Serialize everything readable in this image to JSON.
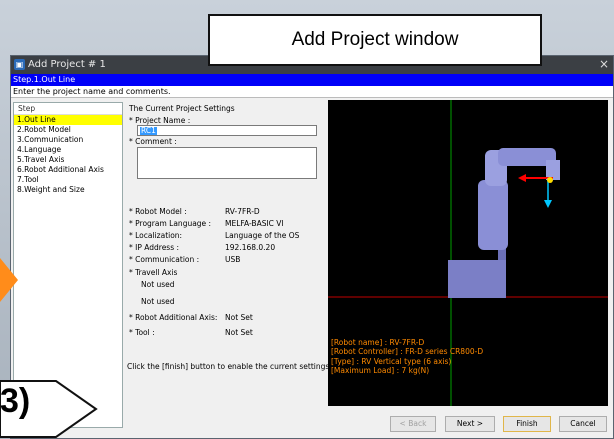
{
  "annotation": {
    "title": "Add Project window",
    "callout": "3)"
  },
  "window": {
    "title": "Add Project # 1",
    "step_header": "Step.1.Out Line",
    "instruction": "Enter the project name and comments."
  },
  "steps": {
    "header": "Step",
    "items": [
      {
        "label": "1.Out Line",
        "active": true
      },
      {
        "label": "2.Robot Model"
      },
      {
        "label": "3.Communication"
      },
      {
        "label": "4.Language"
      },
      {
        "label": "5.Travel Axis"
      },
      {
        "label": "6.Robot Additional Axis"
      },
      {
        "label": "7.Tool"
      },
      {
        "label": "8.Weight and Size"
      }
    ]
  },
  "settings": {
    "header": "The Current Project Settings",
    "project_name_label": "* Project Name :",
    "project_name_value": "RC1",
    "comment_label": "* Comment :",
    "rows": [
      {
        "label": "* Robot Model :",
        "value": "RV-7FR-D"
      },
      {
        "label": "* Program Language :",
        "value": "MELFA-BASIC VI"
      },
      {
        "label": "* Localization:",
        "value": "Language of the OS"
      },
      {
        "label": "* IP Address :",
        "value": "192.168.0.20"
      },
      {
        "label": "* Communication :",
        "value": "USB"
      }
    ],
    "travel_axis_label": "* Travell Axis",
    "travel_axis_line1": "Not used",
    "travel_axis_line2": "Not used",
    "additional_axis_label": "* Robot Additional Axis:",
    "additional_axis_value": "Not Set",
    "tool_label": "* Tool :",
    "tool_value": "Not Set",
    "finish_hint": "Click the [finish] button to enable the current settings."
  },
  "robot_info": [
    "[Robot name] : RV-7FR-D",
    "[Robot Controller] : FR-D series CR800-D",
    "[Type] : RV Vertical type (6 axis)",
    "[Maximum Load] : 7 kg(N)"
  ],
  "buttons": {
    "back": "< Back",
    "next": "Next >",
    "finish": "Finish",
    "cancel": "Cancel"
  },
  "colors": {
    "step_bar": "#0000f8",
    "active_step": "#ffff00",
    "robot_info_text": "#ff8a00",
    "robot_body": "#8a8fd6"
  }
}
